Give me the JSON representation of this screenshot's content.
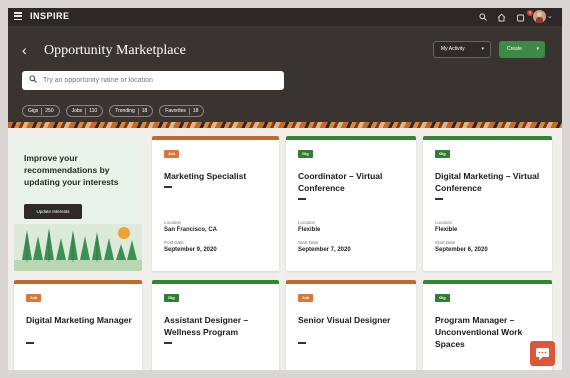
{
  "app": {
    "name": "INSPIRE",
    "notification_count": "9"
  },
  "header": {
    "title": "Opportunity Marketplace",
    "my_activity_label": "My Activity",
    "create_label": "Create"
  },
  "search": {
    "placeholder": "Try an opportunity name or location"
  },
  "chips": [
    {
      "label": "Gigs",
      "count": "250"
    },
    {
      "label": "Jobs",
      "count": "110"
    },
    {
      "label": "Trending",
      "count": "18"
    },
    {
      "label": "Favorites",
      "count": "18"
    }
  ],
  "promo": {
    "text": "Improve your recommendations by updating your interests",
    "button_label": "Update Interests"
  },
  "cards": [
    {
      "tag": "Job",
      "title": "Marketing Specialist",
      "meta1_label": "Location",
      "meta1_value": "San Francisco, CA",
      "meta2_label": "Post Date",
      "meta2_value": "September 9, 2020"
    },
    {
      "tag": "Gig",
      "title": "Coordinator – Virtual Conference",
      "meta1_label": "Location",
      "meta1_value": "Flexible",
      "meta2_label": "Start Date",
      "meta2_value": "September 7, 2020"
    },
    {
      "tag": "Gig",
      "title": "Digital Marketing – Virtual Conference",
      "meta1_label": "Location",
      "meta1_value": "Flexible",
      "meta2_label": "Start Date",
      "meta2_value": "September 6, 2020"
    },
    {
      "tag": "Job",
      "title": "Digital Marketing Manager"
    },
    {
      "tag": "Gig",
      "title": "Assistant Designer – Wellness Program"
    },
    {
      "tag": "Job",
      "title": "Senior Visual Designer"
    },
    {
      "tag": "Gig",
      "title": "Program Manager – Unconventional Work Spaces"
    }
  ],
  "colors": {
    "job": "#c5672a",
    "gig": "#2f8a2f",
    "create": "#3d8a47",
    "header_bg": "#3a3431"
  }
}
